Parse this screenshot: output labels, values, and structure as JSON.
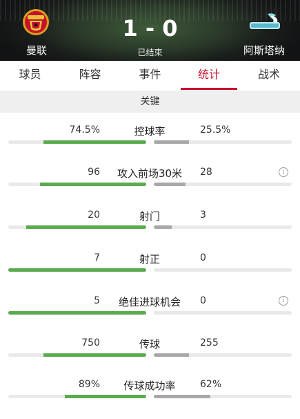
{
  "match": {
    "home_team": "曼联",
    "away_team": "阿斯塔纳",
    "score": "1 - 0",
    "status": "已结束"
  },
  "tabs": [
    {
      "label": "球员",
      "active": false
    },
    {
      "label": "阵容",
      "active": false
    },
    {
      "label": "事件",
      "active": false
    },
    {
      "label": "统计",
      "active": true
    },
    {
      "label": "战术",
      "active": false
    }
  ],
  "section_title": "关键",
  "colors": {
    "accent": "#c8102e",
    "home_bar": "#5aab4e",
    "away_bar": "#a8a8a8",
    "bar_track": "#e9e9e9"
  },
  "stats": [
    {
      "label": "控球率",
      "home": "74.5%",
      "away": "25.5%",
      "home_fraction": 0.745,
      "away_fraction": 0.255,
      "has_info": false
    },
    {
      "label": "攻入前场30米",
      "home": "96",
      "away": "28",
      "home_fraction": 0.77,
      "away_fraction": 0.23,
      "has_info": true
    },
    {
      "label": "射门",
      "home": "20",
      "away": "3",
      "home_fraction": 0.87,
      "away_fraction": 0.13,
      "has_info": false
    },
    {
      "label": "射正",
      "home": "7",
      "away": "0",
      "home_fraction": 1.0,
      "away_fraction": 0.0,
      "has_info": false
    },
    {
      "label": "绝佳进球机会",
      "home": "5",
      "away": "0",
      "home_fraction": 1.0,
      "away_fraction": 0.0,
      "has_info": true
    },
    {
      "label": "传球",
      "home": "750",
      "away": "255",
      "home_fraction": 0.745,
      "away_fraction": 0.255,
      "has_info": false
    },
    {
      "label": "传球成功率",
      "home": "89%",
      "away": "62%",
      "home_fraction": 0.59,
      "away_fraction": 0.41,
      "has_info": false
    }
  ]
}
